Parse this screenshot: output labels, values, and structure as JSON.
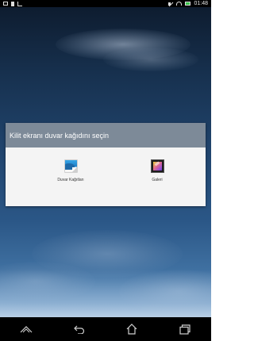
{
  "status_bar": {
    "left_icons": [
      "image-notification-icon",
      "document-notification-icon",
      "signal-notification-icon"
    ],
    "right_icons": [
      "mute-icon",
      "wifi-icon",
      "battery-icon"
    ],
    "time": "01:48"
  },
  "dialog": {
    "title": "Kilit ekranı duvar kağıdını seçin",
    "options": [
      {
        "label": "Duvar Kağıtları",
        "icon": "wallpapers-icon"
      },
      {
        "label": "Galeri",
        "icon": "gallery-icon"
      }
    ]
  },
  "nav_bar": {
    "buttons": [
      "asus-menu-icon",
      "back-icon",
      "home-icon",
      "recent-apps-icon"
    ]
  },
  "colors": {
    "dialog_header": "#7d8a98",
    "dialog_body": "#f4f4f4",
    "status_bar": "#000000",
    "nav_bar": "#000000",
    "battery": "#39c24a"
  }
}
